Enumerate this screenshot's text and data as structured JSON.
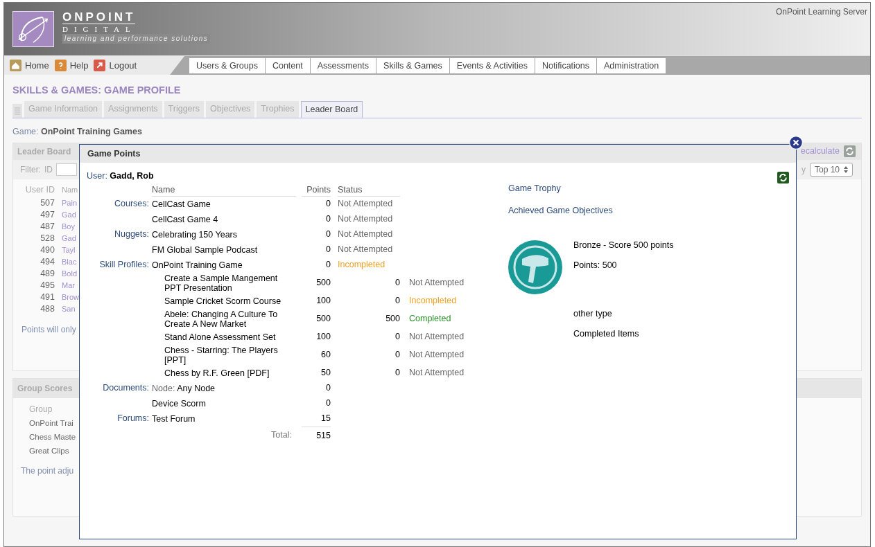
{
  "header": {
    "logo_name": "ONPOINT",
    "logo_sub": "DIGITAL",
    "tagline": "learning and performance solutions",
    "server": "OnPoint Learning Server"
  },
  "quick_links": [
    {
      "label": "Home",
      "kind": "home"
    },
    {
      "label": "Help",
      "kind": "help"
    },
    {
      "label": "Logout",
      "kind": "logout"
    }
  ],
  "nav_tabs": [
    "Users & Groups",
    "Content",
    "Assessments",
    "Skills & Games",
    "Events & Activities",
    "Notifications",
    "Administration"
  ],
  "page_title": "SKILLS & GAMES: GAME PROFILE",
  "sub_tabs": [
    {
      "label": "Game Information",
      "selected": false
    },
    {
      "label": "Assignments",
      "selected": false
    },
    {
      "label": "Triggers",
      "selected": false
    },
    {
      "label": "Objectives",
      "selected": false
    },
    {
      "label": "Trophies",
      "selected": false
    },
    {
      "label": "Leader Board",
      "selected": true
    }
  ],
  "game": {
    "label": "Game:",
    "value": "OnPoint Training Games"
  },
  "leader_board": {
    "title": "Leader Board",
    "filter_label": "Filter:",
    "filter_field": "ID",
    "recalculate": "ecalculate",
    "by": "y",
    "top": "Top 10",
    "columns": [
      "User ID",
      "Nam"
    ],
    "rows": [
      {
        "id": "507",
        "name": "Pain"
      },
      {
        "id": "497",
        "name": "Gad"
      },
      {
        "id": "487",
        "name": "Boy"
      },
      {
        "id": "528",
        "name": "Gad"
      },
      {
        "id": "490",
        "name": "Tayl"
      },
      {
        "id": "494",
        "name": "Blac"
      },
      {
        "id": "489",
        "name": "Bold"
      },
      {
        "id": "495",
        "name": "Mar"
      },
      {
        "id": "491",
        "name": "Brow"
      },
      {
        "id": "488",
        "name": "San"
      }
    ],
    "note": "Points will only"
  },
  "group_scores": {
    "title": "Group Scores",
    "column": "Group",
    "rows": [
      "OnPoint Trai",
      "Chess Maste",
      "Great Clips"
    ],
    "note": "The point adju"
  },
  "dialog": {
    "title": "Game Points",
    "user_label": "User:",
    "user": "Gadd, Rob",
    "columns": [
      "Name",
      "Points",
      "Status"
    ],
    "groups": [
      {
        "label": "Courses:",
        "items": [
          {
            "name": "CellCast Game",
            "points": "0",
            "status": "Not Attempted",
            "kind": "not_attempted"
          },
          {
            "name": "CellCast Game 4",
            "points": "0",
            "status": "Not Attempted",
            "kind": "not_attempted"
          }
        ]
      },
      {
        "label": "Nuggets:",
        "items": [
          {
            "name": "Celebrating 150 Years",
            "points": "0",
            "status": "Not Attempted",
            "kind": "not_attempted"
          },
          {
            "name": "FM Global Sample Podcast",
            "points": "0",
            "status": "Not Attempted",
            "kind": "not_attempted"
          }
        ]
      },
      {
        "label": "Skill Profiles:",
        "items": [
          {
            "name": "OnPoint Training Game",
            "points": "0",
            "status": "Incompleted",
            "kind": "incompleted",
            "children": [
              {
                "name": "Create a Sample Mangement PPT Presentation",
                "points": "500",
                "earned": "0",
                "status": "Not Attempted",
                "kind": "not_attempted"
              },
              {
                "name": "Sample Cricket Scorm Course",
                "points": "100",
                "earned": "0",
                "status": "Incompleted",
                "kind": "incompleted"
              },
              {
                "name": "Abele: Changing A Culture To Create A New Market",
                "points": "500",
                "earned": "500",
                "status": "Completed",
                "kind": "completed"
              },
              {
                "name": "Stand Alone Assessment Set",
                "points": "100",
                "earned": "0",
                "status": "Not Attempted",
                "kind": "not_attempted"
              },
              {
                "name": "Chess - Starring: The Players [PPT]",
                "points": "60",
                "earned": "0",
                "status": "Not Attempted",
                "kind": "not_attempted"
              },
              {
                "name": "Chess by R.F. Green [PDF]",
                "points": "50",
                "earned": "0",
                "status": "Not Attempted",
                "kind": "not_attempted"
              }
            ]
          }
        ]
      },
      {
        "label": "Documents:",
        "items": [
          {
            "prefix": "Node:",
            "name": "Any Node",
            "points": "0"
          },
          {
            "name": "Device Scorm",
            "points": "0"
          }
        ]
      },
      {
        "label": "Forums:",
        "items": [
          {
            "name": "Test Forum",
            "points": "15"
          }
        ]
      }
    ],
    "total_label": "Total:",
    "total": "515",
    "links": [
      "Game Trophy",
      "Achieved Game Objectives"
    ],
    "trophy": {
      "title": "Bronze - Score 500 points",
      "points": "Points: 500",
      "type": "other type",
      "items": "Completed Items"
    }
  }
}
